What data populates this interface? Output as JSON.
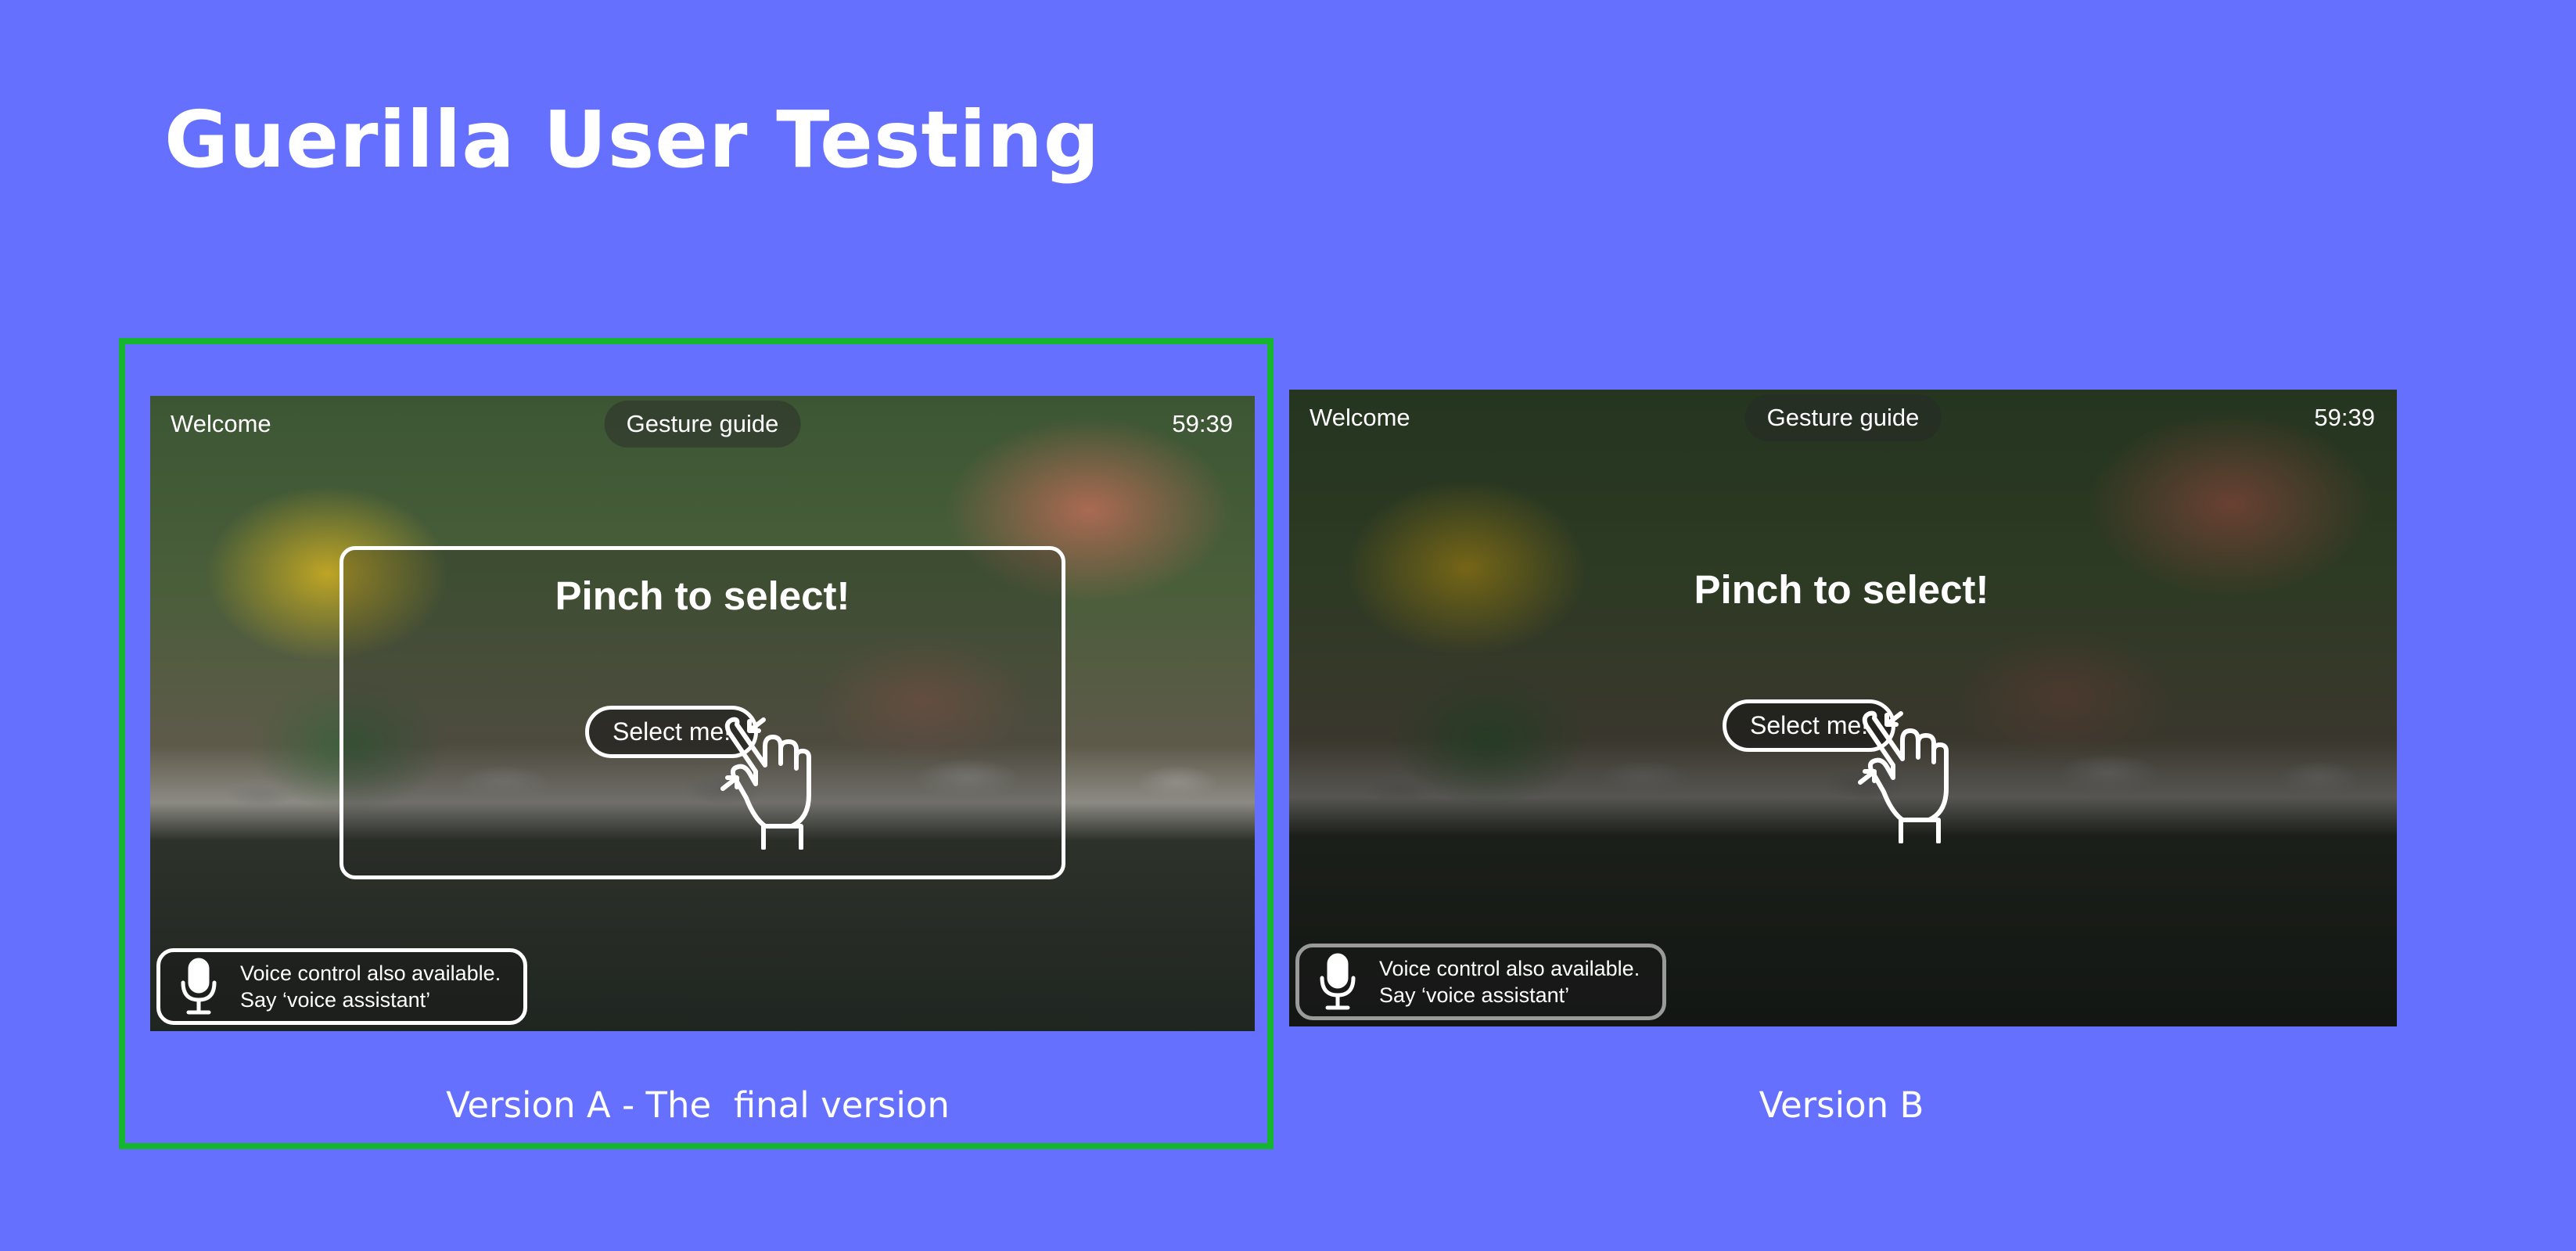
{
  "page": {
    "title": "Guerilla User Testing"
  },
  "versions": [
    {
      "caption": "Version A - The  final version",
      "screen": {
        "welcome": "Welcome",
        "gesture_guide": "Gesture guide",
        "time": "59:39",
        "instruction": "Pinch to select!",
        "select_button": "Select me!",
        "voice_line1": "Voice control also available.",
        "voice_line2": "Say ‘voice assistant’"
      }
    },
    {
      "caption": "Version B",
      "screen": {
        "welcome": "Welcome",
        "gesture_guide": "Gesture guide",
        "time": "59:39",
        "instruction": "Pinch to select!",
        "select_button": "Select me!",
        "voice_line1": "Voice control also available.",
        "voice_line2": "Say ‘voice assistant’"
      }
    }
  ],
  "icons": {
    "hand": "pinch-hand-icon",
    "mic": "microphone-icon"
  },
  "colors": {
    "background": "#6570ff",
    "selected_outline": "#16b52f"
  }
}
